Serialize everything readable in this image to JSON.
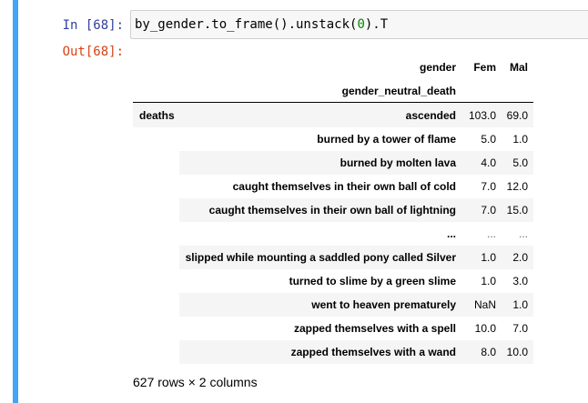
{
  "cell": {
    "in_prompt": "In [68]:",
    "out_prompt": "Out[68]:",
    "code_part1": "by_gender.to_frame().unstack(",
    "code_num": "0",
    "code_part2": ").T"
  },
  "dataframe": {
    "columns_name": "gender",
    "columns": [
      "Fem",
      "Mal"
    ],
    "index_names": [
      "gender_neutral_death"
    ],
    "outer_index": "deaths",
    "rows": [
      {
        "label": "ascended",
        "fem": "103.0",
        "mal": "69.0"
      },
      {
        "label": "burned by a tower of flame",
        "fem": "5.0",
        "mal": "1.0"
      },
      {
        "label": "burned by molten lava",
        "fem": "4.0",
        "mal": "5.0"
      },
      {
        "label": "caught themselves in their own ball of cold",
        "fem": "7.0",
        "mal": "12.0"
      },
      {
        "label": "caught themselves in their own ball of lightning",
        "fem": "7.0",
        "mal": "15.0"
      },
      {
        "label": "...",
        "fem": "...",
        "mal": "..."
      },
      {
        "label": "slipped while mounting a saddled pony called Silver",
        "fem": "1.0",
        "mal": "2.0"
      },
      {
        "label": "turned to slime by a green slime",
        "fem": "1.0",
        "mal": "3.0"
      },
      {
        "label": "went to heaven prematurely",
        "fem": "NaN",
        "mal": "1.0"
      },
      {
        "label": "zapped themselves with a spell",
        "fem": "10.0",
        "mal": "7.0"
      },
      {
        "label": "zapped themselves with a wand",
        "fem": "8.0",
        "mal": "10.0"
      }
    ],
    "footer": "627 rows × 2 columns"
  }
}
